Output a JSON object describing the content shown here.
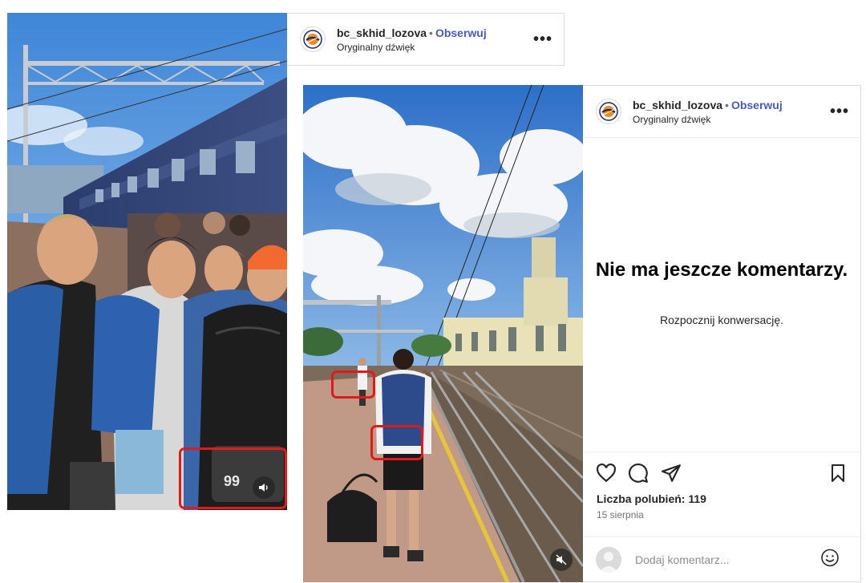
{
  "left_post": {
    "username": "bc_skhid_lozova",
    "separator": "•",
    "follow_label": "Obserwuj",
    "audio_label": "Oryginalny dźwięk",
    "more_label": "•••",
    "jersey_number": "99",
    "icons": {
      "avatar": "team-logo-icon",
      "volume": "speaker-on-icon"
    }
  },
  "right_post": {
    "username": "bc_skhid_lozova",
    "separator": "•",
    "follow_label": "Obserwuj",
    "audio_label": "Oryginalny dźwięk",
    "more_label": "•••",
    "empty_title": "Nie ma jeszcze komentarzy.",
    "empty_subtitle": "Rozpocznij konwersację.",
    "likes_text": "Liczba polubień: 119",
    "date_text": "15 sierpnia",
    "comment_placeholder": "Dodaj komentarz...",
    "icons": {
      "like": "heart-icon",
      "comment": "comment-icon",
      "share": "send-icon",
      "save": "bookmark-icon",
      "emoji": "emoji-icon",
      "volume": "speaker-muted-icon"
    }
  },
  "colors": {
    "follow": "#4a5bb5",
    "highlight": "#e01a1a",
    "border": "#dbdbdb"
  }
}
